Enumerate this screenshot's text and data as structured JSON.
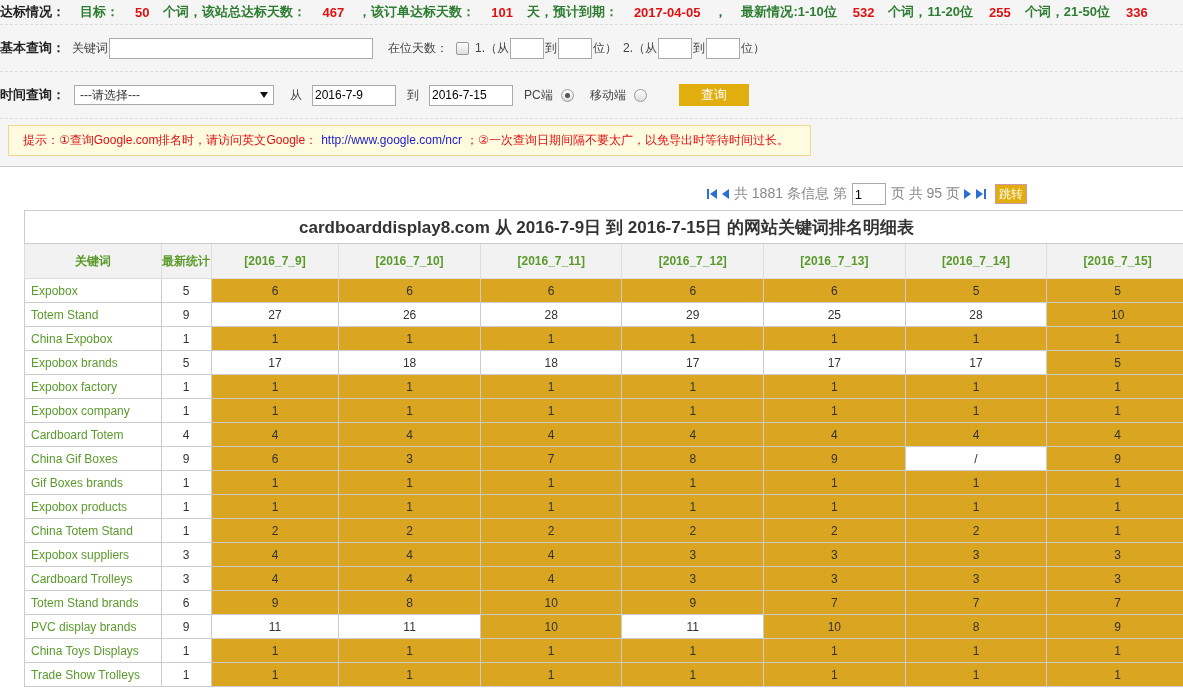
{
  "stats": {
    "title": "达标情况：",
    "segments": [
      {
        "kind": "label",
        "text": "目标："
      },
      {
        "kind": "value",
        "text": "50"
      },
      {
        "kind": "label",
        "text": "个词，该站总达标天数："
      },
      {
        "kind": "value",
        "text": "467"
      },
      {
        "kind": "label",
        "text": "，该订单达标天数："
      },
      {
        "kind": "value",
        "text": "101"
      },
      {
        "kind": "label",
        "text": "天，预计到期："
      },
      {
        "kind": "value",
        "text": "2017-04-05"
      },
      {
        "kind": "label",
        "text": "，"
      },
      {
        "kind": "label",
        "text": "最新情况:1-10位"
      },
      {
        "kind": "value",
        "text": "532"
      },
      {
        "kind": "label",
        "text": "个词，11-20位"
      },
      {
        "kind": "value",
        "text": "255"
      },
      {
        "kind": "label",
        "text": "个词，21-50位"
      },
      {
        "kind": "value",
        "text": "336"
      }
    ]
  },
  "basic_query": {
    "title": "基本查询：",
    "keyword_label": "关键词",
    "days_label": "在位天数：",
    "days_checked": false,
    "range1_prefix": "1.（从",
    "range2_prefix": "2.（从",
    "to": "到",
    "suffix": "位）",
    "to_2": "到",
    "suffix_2": "位）"
  },
  "time_query": {
    "title": "时间查询：",
    "select": "---请选择---",
    "from_label": "从",
    "from": "2016-7-9",
    "to_label": "到",
    "to": "2016-7-15",
    "radios": [
      {
        "label": "PC端",
        "selected": true
      },
      {
        "label": "移动端",
        "selected": false
      }
    ],
    "button": "查询"
  },
  "notice": {
    "before": "提示：①查询Google.com排名时，请访问英文Google：",
    "link": "http://www.google.com/ncr",
    "after": "；②一次查询日期间隔不要太广，以免导出时等待时间过长。"
  },
  "pager": {
    "total": "共 1881 条信息 第",
    "page": "1",
    "pages": "页 共 95 页",
    "button": "跳转"
  },
  "table": {
    "title": "cardboarddisplay8.com 从 2016-7-9日 到 2016-7-15日 的网站关键词排名明细表",
    "keyword_header": "关键词",
    "latest_header": "最新统计",
    "date_columns": [
      "[2016_7_9]",
      "[2016_7_10]",
      "[2016_7_11]",
      "[2016_7_12]",
      "[2016_7_13]",
      "[2016_7_14]",
      "[2016_7_15]"
    ],
    "rows": [
      {
        "keyword": "Expobox",
        "latest": "5",
        "cells": [
          {
            "text": "6",
            "met": true
          },
          {
            "text": "6",
            "met": true
          },
          {
            "text": "6",
            "met": true
          },
          {
            "text": "6",
            "met": true
          },
          {
            "text": "6",
            "met": true
          },
          {
            "text": "5",
            "met": true
          },
          {
            "text": "5",
            "met": true
          }
        ]
      },
      {
        "keyword": "Totem Stand",
        "latest": "9",
        "cells": [
          {
            "text": "27",
            "met": false
          },
          {
            "text": "26",
            "met": false
          },
          {
            "text": "28",
            "met": false
          },
          {
            "text": "29",
            "met": false
          },
          {
            "text": "25",
            "met": false
          },
          {
            "text": "28",
            "met": false
          },
          {
            "text": "10",
            "met": true
          }
        ]
      },
      {
        "keyword": "China Expobox",
        "latest": "1",
        "cells": [
          {
            "text": "1",
            "met": true
          },
          {
            "text": "1",
            "met": true
          },
          {
            "text": "1",
            "met": true
          },
          {
            "text": "1",
            "met": true
          },
          {
            "text": "1",
            "met": true
          },
          {
            "text": "1",
            "met": true
          },
          {
            "text": "1",
            "met": true
          }
        ]
      },
      {
        "keyword": "Expobox brands",
        "latest": "5",
        "cells": [
          {
            "text": "17",
            "met": false
          },
          {
            "text": "18",
            "met": false
          },
          {
            "text": "18",
            "met": false
          },
          {
            "text": "17",
            "met": false
          },
          {
            "text": "17",
            "met": false
          },
          {
            "text": "17",
            "met": false
          },
          {
            "text": "5",
            "met": true
          }
        ]
      },
      {
        "keyword": "Expobox factory",
        "latest": "1",
        "cells": [
          {
            "text": "1",
            "met": true
          },
          {
            "text": "1",
            "met": true
          },
          {
            "text": "1",
            "met": true
          },
          {
            "text": "1",
            "met": true
          },
          {
            "text": "1",
            "met": true
          },
          {
            "text": "1",
            "met": true
          },
          {
            "text": "1",
            "met": true
          }
        ]
      },
      {
        "keyword": "Expobox company",
        "latest": "1",
        "cells": [
          {
            "text": "1",
            "met": true
          },
          {
            "text": "1",
            "met": true
          },
          {
            "text": "1",
            "met": true
          },
          {
            "text": "1",
            "met": true
          },
          {
            "text": "1",
            "met": true
          },
          {
            "text": "1",
            "met": true
          },
          {
            "text": "1",
            "met": true
          }
        ]
      },
      {
        "keyword": "Cardboard Totem",
        "latest": "4",
        "cells": [
          {
            "text": "4",
            "met": true
          },
          {
            "text": "4",
            "met": true
          },
          {
            "text": "4",
            "met": true
          },
          {
            "text": "4",
            "met": true
          },
          {
            "text": "4",
            "met": true
          },
          {
            "text": "4",
            "met": true
          },
          {
            "text": "4",
            "met": true
          }
        ]
      },
      {
        "keyword": "China Gif Boxes",
        "latest": "9",
        "cells": [
          {
            "text": "6",
            "met": true
          },
          {
            "text": "3",
            "met": true
          },
          {
            "text": "7",
            "met": true
          },
          {
            "text": "8",
            "met": true
          },
          {
            "text": "9",
            "met": true
          },
          {
            "text": "/",
            "met": false
          },
          {
            "text": "9",
            "met": true
          }
        ]
      },
      {
        "keyword": "Gif Boxes brands",
        "latest": "1",
        "cells": [
          {
            "text": "1",
            "met": true
          },
          {
            "text": "1",
            "met": true
          },
          {
            "text": "1",
            "met": true
          },
          {
            "text": "1",
            "met": true
          },
          {
            "text": "1",
            "met": true
          },
          {
            "text": "1",
            "met": true
          },
          {
            "text": "1",
            "met": true
          }
        ]
      },
      {
        "keyword": "Expobox products",
        "latest": "1",
        "cells": [
          {
            "text": "1",
            "met": true
          },
          {
            "text": "1",
            "met": true
          },
          {
            "text": "1",
            "met": true
          },
          {
            "text": "1",
            "met": true
          },
          {
            "text": "1",
            "met": true
          },
          {
            "text": "1",
            "met": true
          },
          {
            "text": "1",
            "met": true
          }
        ]
      },
      {
        "keyword": "China Totem Stand",
        "latest": "1",
        "cells": [
          {
            "text": "2",
            "met": true
          },
          {
            "text": "2",
            "met": true
          },
          {
            "text": "2",
            "met": true
          },
          {
            "text": "2",
            "met": true
          },
          {
            "text": "2",
            "met": true
          },
          {
            "text": "2",
            "met": true
          },
          {
            "text": "1",
            "met": true
          }
        ]
      },
      {
        "keyword": "Expobox suppliers",
        "latest": "3",
        "cells": [
          {
            "text": "4",
            "met": true
          },
          {
            "text": "4",
            "met": true
          },
          {
            "text": "4",
            "met": true
          },
          {
            "text": "3",
            "met": true
          },
          {
            "text": "3",
            "met": true
          },
          {
            "text": "3",
            "met": true
          },
          {
            "text": "3",
            "met": true
          }
        ]
      },
      {
        "keyword": "Cardboard Trolleys",
        "latest": "3",
        "cells": [
          {
            "text": "4",
            "met": true
          },
          {
            "text": "4",
            "met": true
          },
          {
            "text": "4",
            "met": true
          },
          {
            "text": "3",
            "met": true
          },
          {
            "text": "3",
            "met": true
          },
          {
            "text": "3",
            "met": true
          },
          {
            "text": "3",
            "met": true
          }
        ]
      },
      {
        "keyword": "Totem Stand brands",
        "latest": "6",
        "cells": [
          {
            "text": "9",
            "met": true
          },
          {
            "text": "8",
            "met": true
          },
          {
            "text": "10",
            "met": true
          },
          {
            "text": "9",
            "met": true
          },
          {
            "text": "7",
            "met": true
          },
          {
            "text": "7",
            "met": true
          },
          {
            "text": "7",
            "met": true
          }
        ]
      },
      {
        "keyword": "PVC display brands",
        "latest": "9",
        "cells": [
          {
            "text": "11",
            "met": false
          },
          {
            "text": "11",
            "met": false
          },
          {
            "text": "10",
            "met": true
          },
          {
            "text": "11",
            "met": false
          },
          {
            "text": "10",
            "met": true
          },
          {
            "text": "8",
            "met": true
          },
          {
            "text": "9",
            "met": true
          }
        ]
      },
      {
        "keyword": "China Toys Displays",
        "latest": "1",
        "cells": [
          {
            "text": "1",
            "met": true
          },
          {
            "text": "1",
            "met": true
          },
          {
            "text": "1",
            "met": true
          },
          {
            "text": "1",
            "met": true
          },
          {
            "text": "1",
            "met": true
          },
          {
            "text": "1",
            "met": true
          },
          {
            "text": "1",
            "met": true
          }
        ]
      },
      {
        "keyword": "Trade Show Trolleys",
        "latest": "1",
        "cells": [
          {
            "text": "1",
            "met": true
          },
          {
            "text": "1",
            "met": true
          },
          {
            "text": "1",
            "met": true
          },
          {
            "text": "1",
            "met": true
          },
          {
            "text": "1",
            "met": true
          },
          {
            "text": "1",
            "met": true
          },
          {
            "text": "1",
            "met": true
          }
        ]
      }
    ]
  }
}
